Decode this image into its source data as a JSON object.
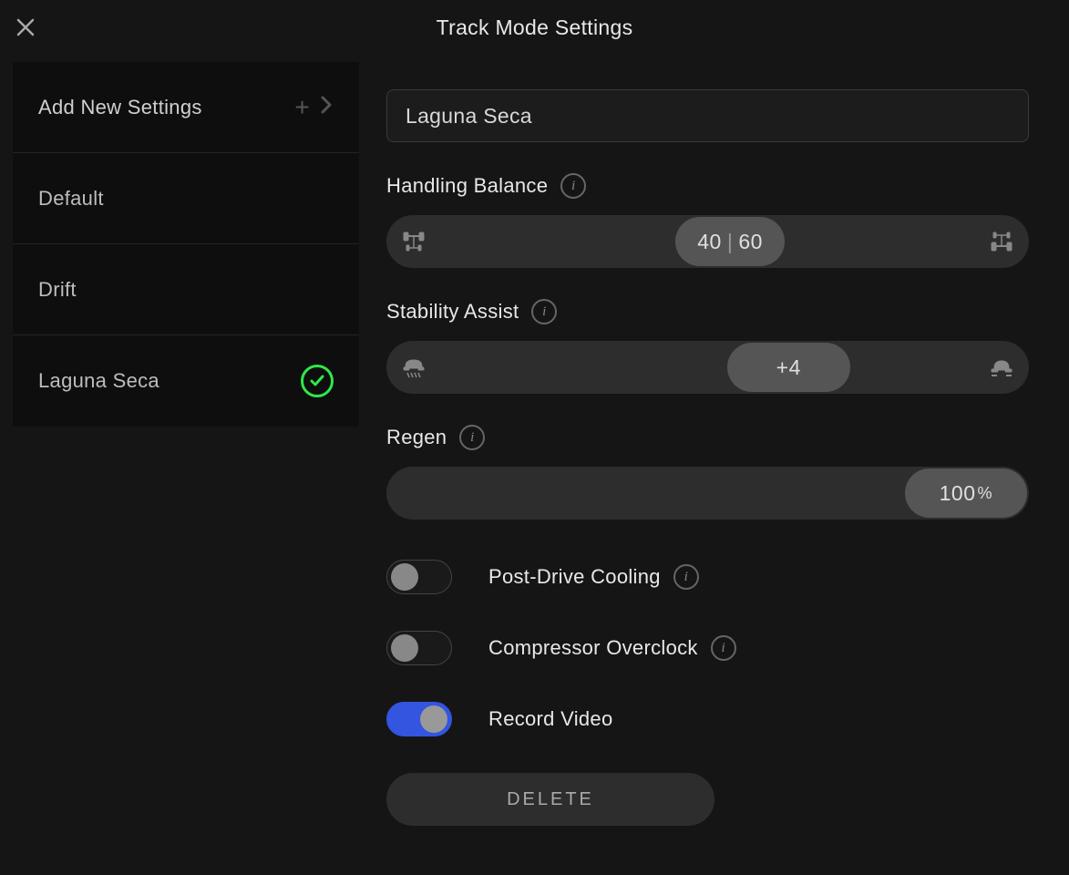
{
  "header": {
    "title": "Track Mode Settings"
  },
  "sidebar": {
    "add_label": "Add New Settings",
    "profiles": [
      {
        "name": "Default",
        "active": false
      },
      {
        "name": "Drift",
        "active": false
      },
      {
        "name": "Laguna Seca",
        "active": true
      }
    ]
  },
  "form": {
    "name_value": "Laguna Seca",
    "handling": {
      "label": "Handling Balance",
      "front": "40",
      "rear": "60"
    },
    "stability": {
      "label": "Stability Assist",
      "value": "+4"
    },
    "regen": {
      "label": "Regen",
      "value": "100",
      "unit": "%"
    },
    "toggles": {
      "post_drive_cooling": {
        "label": "Post-Drive Cooling",
        "on": false
      },
      "compressor_overclock": {
        "label": "Compressor Overclock",
        "on": false
      },
      "record_video": {
        "label": "Record Video",
        "on": true
      }
    },
    "delete_label": "DELETE"
  }
}
